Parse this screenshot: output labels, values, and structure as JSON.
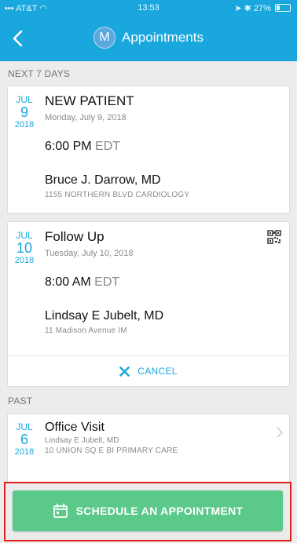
{
  "status_bar": {
    "carrier": "AT&T",
    "time": "13:53",
    "battery": "27%",
    "battery_level": 0.27
  },
  "nav": {
    "avatar_initial": "M",
    "title": "Appointments"
  },
  "sections": {
    "upcoming_label": "NEXT 7 DAYS",
    "past_label": "PAST"
  },
  "upcoming": [
    {
      "month": "JUL",
      "day": "9",
      "year": "2018",
      "type": "NEW PATIENT",
      "date_text": "Monday, July 9, 2018",
      "time": "6:00 PM",
      "tz": "EDT",
      "doctor": "Bruce J. Darrow, MD",
      "location": "1155 NORTHERN BLVD CARDIOLOGY"
    },
    {
      "month": "JUL",
      "day": "10",
      "year": "2018",
      "type": "Follow Up",
      "date_text": "Tuesday, July 10, 2018",
      "time": "8:00 AM",
      "tz": "EDT",
      "doctor": "Lindsay E Jubelt, MD",
      "location": "11 Madison Avenue IM",
      "cancel_label": "CANCEL"
    }
  ],
  "past": [
    {
      "month": "JUL",
      "day": "6",
      "year": "2018",
      "type": "Office Visit",
      "doctor": "Lindsay E Jubelt, MD",
      "location": "10 UNION SQ E BI PRIMARY CARE"
    }
  ],
  "cta": {
    "label": "SCHEDULE AN APPOINTMENT"
  },
  "icons": {
    "back": "chevron-left-icon",
    "qr": "qr-code-icon",
    "cancel": "close-icon",
    "chevron": "chevron-right-icon",
    "calendar": "calendar-icon"
  },
  "colors": {
    "brand_blue": "#1aa7de",
    "cta_green": "#5ac98a",
    "highlight_red": "#e0201f"
  }
}
